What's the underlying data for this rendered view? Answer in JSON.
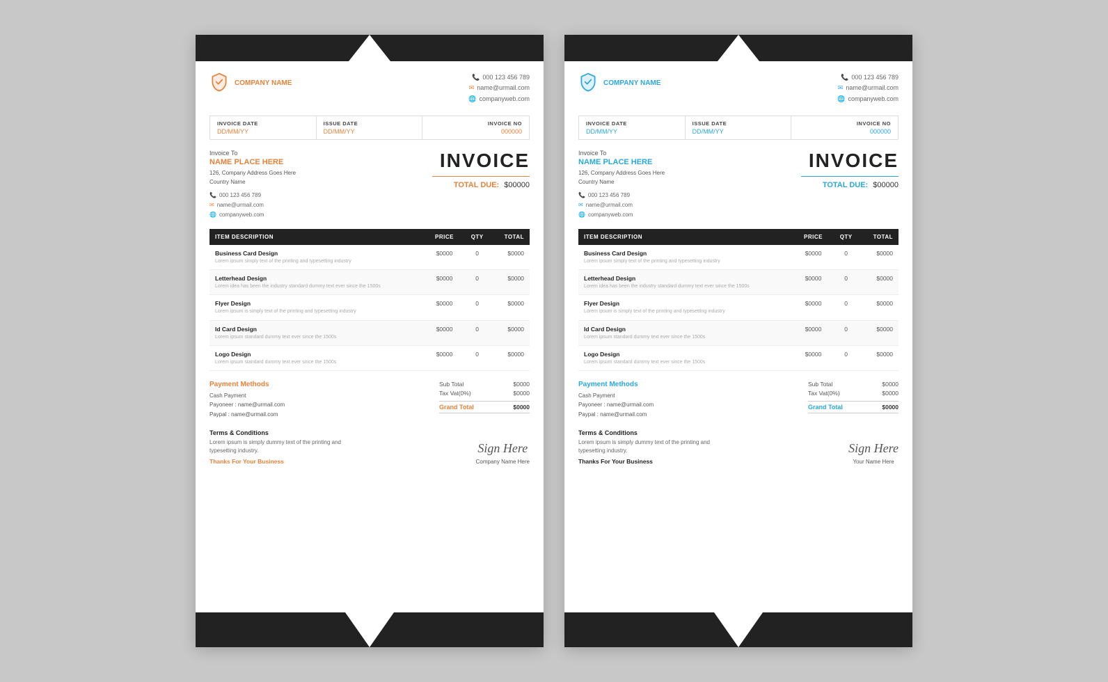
{
  "background": "#c8c8c8",
  "invoices": [
    {
      "variant": "orange",
      "accentColor": "#e8823a",
      "company": {
        "name": "COMPANY NAME",
        "phone": "000 123 456 789",
        "email": "name@urmail.com",
        "web": "companyweb.com"
      },
      "dates": {
        "invoiceDate": {
          "label": "INVOICE DATE",
          "value": "DD/MM/YY"
        },
        "issueDate": {
          "label": "ISSUE DATE",
          "value": "DD/MM/YY"
        },
        "invoiceNo": {
          "label": "INVOICE NO",
          "value": "000000"
        }
      },
      "invoiceTo": {
        "label": "Invoice To",
        "name": "NAME PLACE HERE",
        "address1": "126, Company Address Goes Here",
        "address2": "Country Name",
        "phone": "000 123 456 789",
        "email": "name@urmail.com",
        "web": "companyweb.com"
      },
      "invoiceTitle": "INVOICE",
      "totalDueLabel": "TOTAL DUE:",
      "totalDueValue": "$00000",
      "tableHeaders": [
        "ITEM DESCRIPTION",
        "PRICE",
        "QTY",
        "TOTAL"
      ],
      "items": [
        {
          "name": "Business Card Design",
          "desc": "Lorem ipsum simply text of the printing and typesetting industry",
          "price": "$0000",
          "qty": "0",
          "total": "$0000"
        },
        {
          "name": "Letterhead Design",
          "desc": "Lorem idea has been the industry standard dummy text ever since the 1500s",
          "price": "$0000",
          "qty": "0",
          "total": "$0000"
        },
        {
          "name": "Flyer Design",
          "desc": "Lorem ipsum is simply text of the printing and typesetting industry",
          "price": "$0000",
          "qty": "0",
          "total": "$0000"
        },
        {
          "name": "Id Card Design",
          "desc": "Lorem ipsum standard dummy text ever since the 1500s",
          "price": "$0000",
          "qty": "0",
          "total": "$0000"
        },
        {
          "name": "Logo Design",
          "desc": "Lorem ipsum standard dummy text ever since the 1500s",
          "price": "$0000",
          "qty": "0",
          "total": "$0000"
        }
      ],
      "payment": {
        "title": "Payment Methods",
        "methods": [
          "Cash Payment",
          "Payoneer : name@urmail.com",
          "Paypal  : name@urmail.com"
        ],
        "subTotal": {
          "label": "Sub Total",
          "value": "$0000"
        },
        "tax": {
          "label": "Tax Vat(0%)",
          "value": "$0000"
        },
        "grandTotal": {
          "label": "Grand Total",
          "value": "$0000"
        }
      },
      "terms": {
        "title": "Terms & Conditions",
        "text": "Lorem ipsum is simply dummy text of the printing and typesetting industry.",
        "thanks": "Thanks For Your Business"
      },
      "sign": {
        "signHere": "Sign Here",
        "name": "Company Name Here"
      }
    },
    {
      "variant": "blue",
      "accentColor": "#29a8e0",
      "company": {
        "name": "COMPANY NAME",
        "phone": "000 123 456 789",
        "email": "name@urmail.com",
        "web": "companyweb.com"
      },
      "dates": {
        "invoiceDate": {
          "label": "INVOICE DATE",
          "value": "DD/MM/YY"
        },
        "issueDate": {
          "label": "ISSUE DATE",
          "value": "DD/MM/YY"
        },
        "invoiceNo": {
          "label": "INVOICE NO",
          "value": "000000"
        }
      },
      "invoiceTo": {
        "label": "Invoice To",
        "name": "NAME PLACE HERE",
        "address1": "126, Company Address Goes Here",
        "address2": "Country Name",
        "phone": "000 123 456 789",
        "email": "name@urmail.com",
        "web": "companyweb.com"
      },
      "invoiceTitle": "INVOICE",
      "totalDueLabel": "TOTAL DUE:",
      "totalDueValue": "$00000",
      "tableHeaders": [
        "ITEM DESCRIPTION",
        "PRICE",
        "QTY",
        "TOTAL"
      ],
      "items": [
        {
          "name": "Business Card Design",
          "desc": "Lorem ipsum simply text of the printing and typesetting industry",
          "price": "$0000",
          "qty": "0",
          "total": "$0000"
        },
        {
          "name": "Letterhead Design",
          "desc": "Lorem idea has been the industry standard dummy text ever since the 1500s",
          "price": "$0000",
          "qty": "0",
          "total": "$0000"
        },
        {
          "name": "Flyer Design",
          "desc": "Lorem ipsum is simply text of the printing and typesetting industry",
          "price": "$0000",
          "qty": "0",
          "total": "$0000"
        },
        {
          "name": "Id Card Design",
          "desc": "Lorem ipsum standard dummy text ever since the 1500s",
          "price": "$0000",
          "qty": "0",
          "total": "$0000"
        },
        {
          "name": "Logo Design",
          "desc": "Lorem ipsum standard dummy text ever since the 1500s",
          "price": "$0000",
          "qty": "0",
          "total": "$0000"
        }
      ],
      "payment": {
        "title": "Payment Methods",
        "methods": [
          "Cash Payment",
          "Payoneer : name@urmail.com",
          "Paypal  : name@urmail.com"
        ],
        "subTotal": {
          "label": "Sub Total",
          "value": "$0000"
        },
        "tax": {
          "label": "Tax Vat(0%)",
          "value": "$0000"
        },
        "grandTotal": {
          "label": "Grand Total",
          "value": "$0000"
        }
      },
      "terms": {
        "title": "Terms & Conditions",
        "text": "Lorem ipsum is simply dummy text of the printing and typesetting industry.",
        "thanks": "Thanks For Your Business"
      },
      "sign": {
        "signHere": "Sign Here",
        "name": "Your Name Here"
      }
    }
  ]
}
